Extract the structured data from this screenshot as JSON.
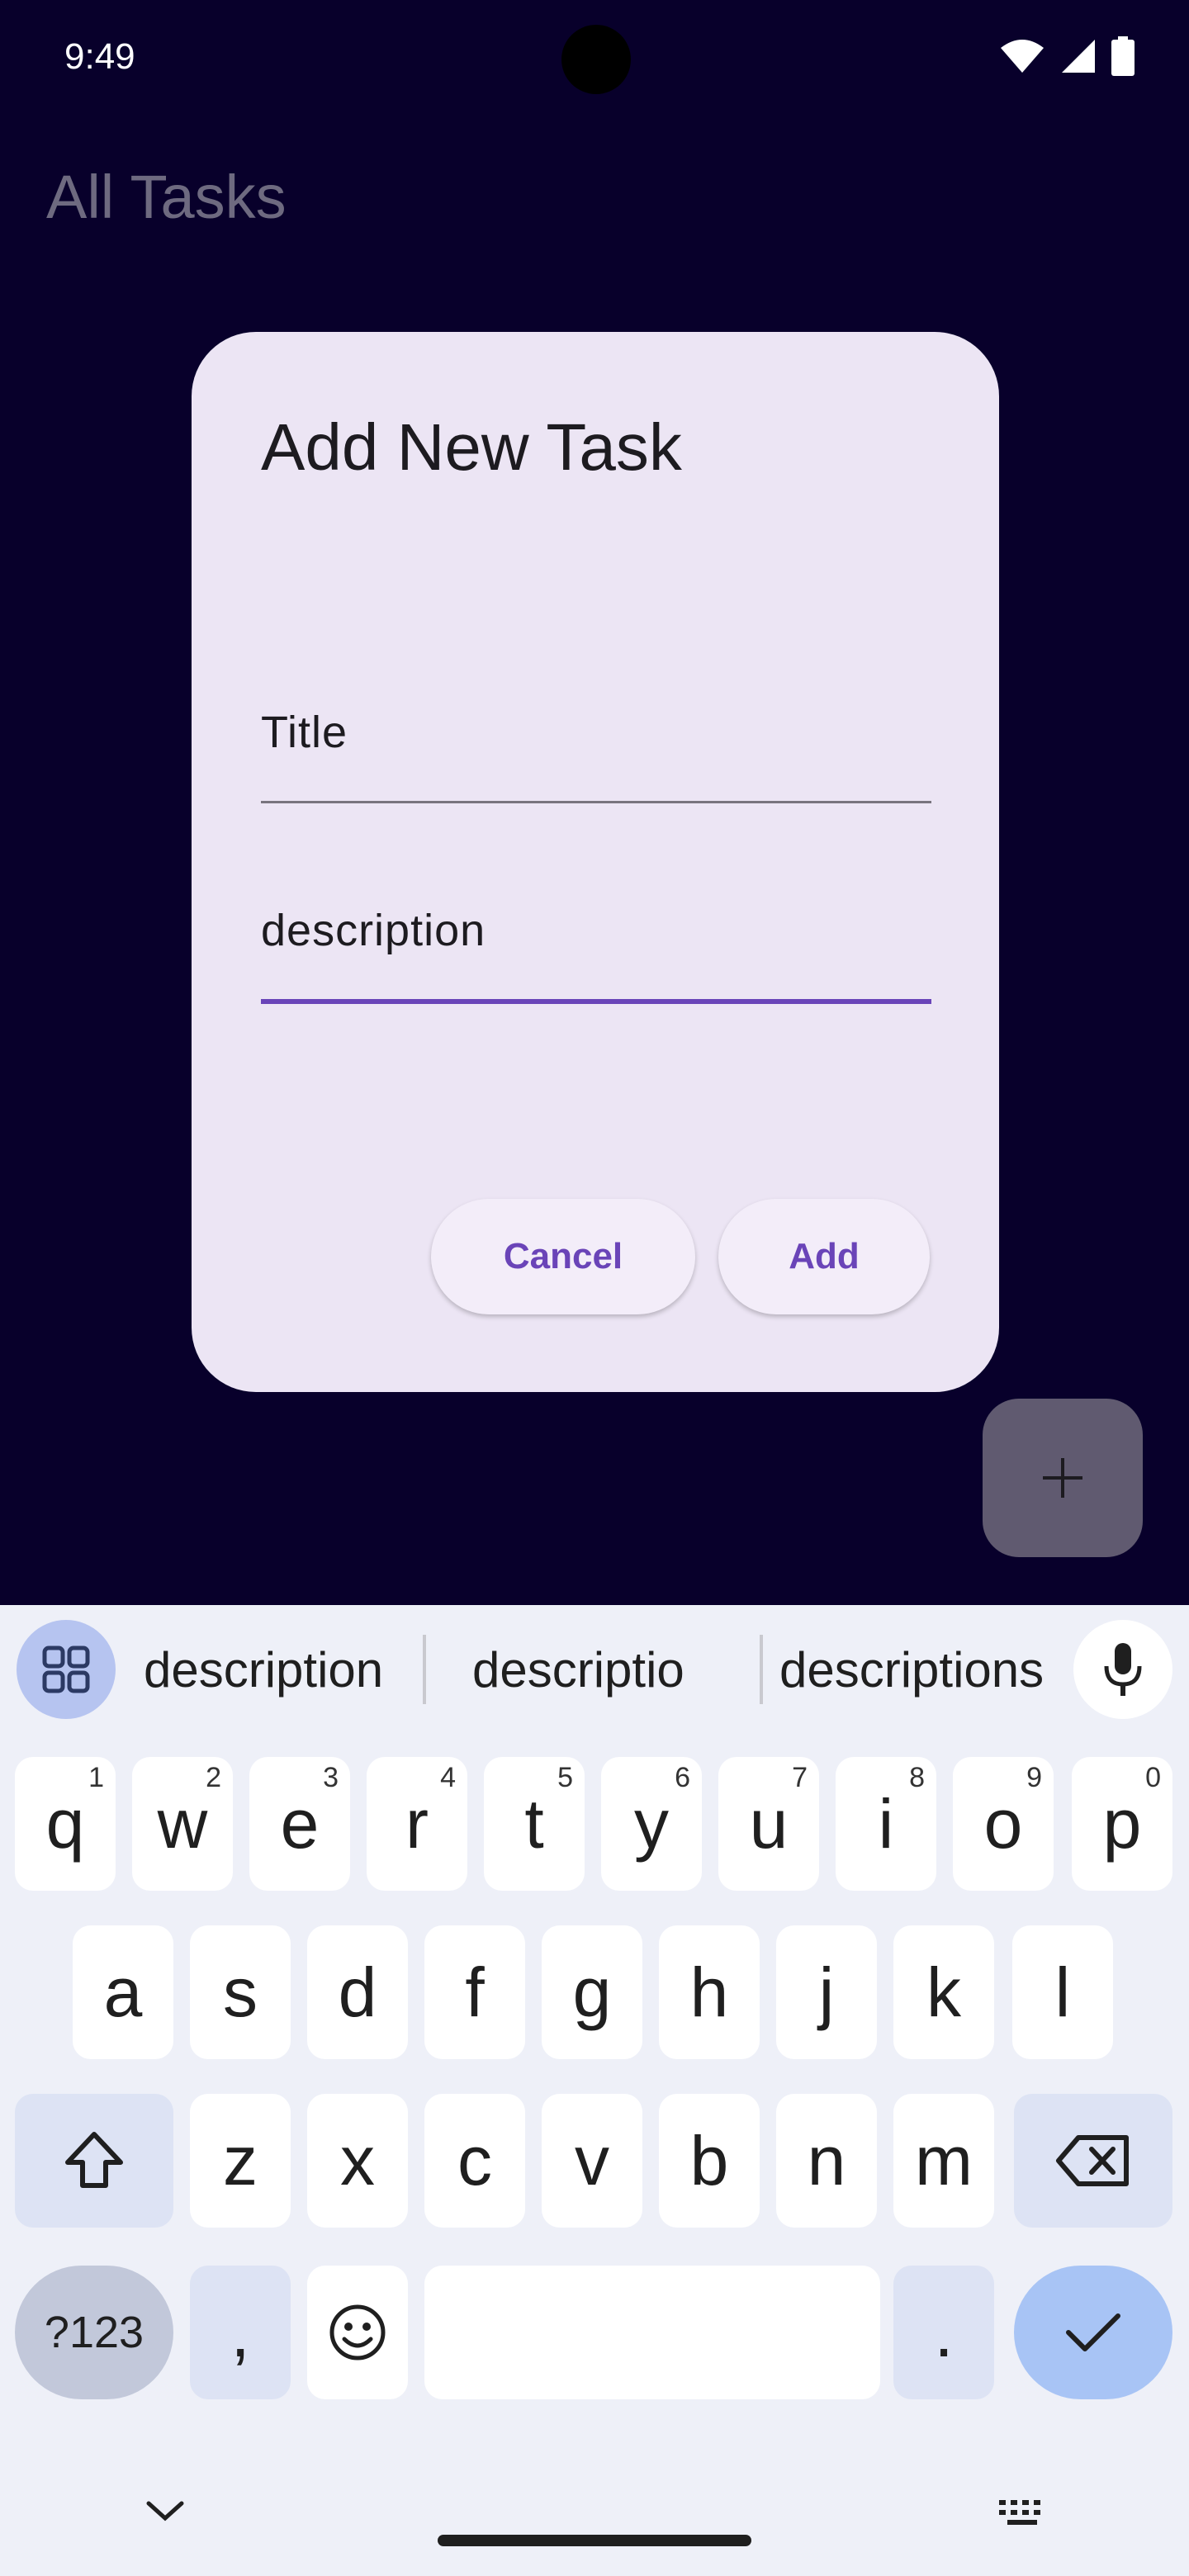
{
  "status_bar": {
    "time": "9:49"
  },
  "app": {
    "title": "All Tasks",
    "fab_icon": "plus-icon"
  },
  "dialog": {
    "title": "Add New Task",
    "title_field": {
      "value": "Title"
    },
    "description_field": {
      "value": "description",
      "focused": true
    },
    "cancel_label": "Cancel",
    "add_label": "Add"
  },
  "keyboard": {
    "suggestions": [
      "description",
      "descriptio",
      "descriptions"
    ],
    "row1": [
      {
        "key": "q",
        "hint": "1"
      },
      {
        "key": "w",
        "hint": "2"
      },
      {
        "key": "e",
        "hint": "3"
      },
      {
        "key": "r",
        "hint": "4"
      },
      {
        "key": "t",
        "hint": "5"
      },
      {
        "key": "y",
        "hint": "6"
      },
      {
        "key": "u",
        "hint": "7"
      },
      {
        "key": "i",
        "hint": "8"
      },
      {
        "key": "o",
        "hint": "9"
      },
      {
        "key": "p",
        "hint": "0"
      }
    ],
    "row2": [
      "a",
      "s",
      "d",
      "f",
      "g",
      "h",
      "j",
      "k",
      "l"
    ],
    "row3": [
      "z",
      "x",
      "c",
      "v",
      "b",
      "n",
      "m"
    ],
    "symbols_label": "?123",
    "comma_label": ",",
    "period_label": "."
  },
  "colors": {
    "background": "#08002b",
    "dialog": "#ece5f4",
    "accent": "#6a44b8",
    "keyboard": "#eef0f8",
    "action_key": "#a8c4f5"
  }
}
